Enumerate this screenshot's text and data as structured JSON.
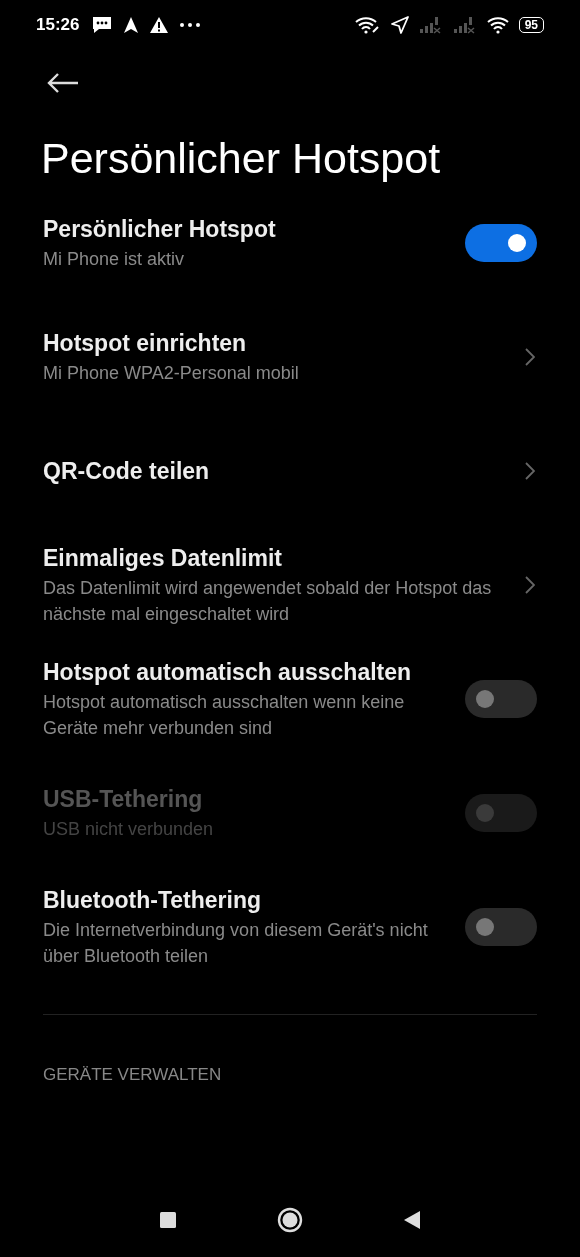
{
  "status_bar": {
    "time": "15:26",
    "battery": "95"
  },
  "title": "Persönlicher Hotspot",
  "settings": [
    {
      "kind": "toggle",
      "title": "Persönlicher Hotspot",
      "subtitle": "Mi Phone ist aktiv",
      "on": true,
      "disabled": false
    },
    {
      "kind": "link",
      "title": "Hotspot einrichten",
      "subtitle": "Mi Phone WPA2-Personal mobil"
    },
    {
      "kind": "link",
      "title": "QR-Code teilen"
    },
    {
      "kind": "link",
      "title": "Einmaliges Datenlimit",
      "subtitle": "Das Datenlimit wird angewendet sobald der Hotspot das nächste mal eingeschaltet wird"
    },
    {
      "kind": "toggle",
      "title": "Hotspot automatisch ausschalten",
      "subtitle": "Hotspot automatisch ausschalten wenn keine Geräte mehr verbunden sind",
      "on": false,
      "disabled": false
    },
    {
      "kind": "toggle",
      "title": "USB-Tethering",
      "subtitle": "USB nicht verbunden",
      "on": false,
      "disabled": true
    },
    {
      "kind": "toggle",
      "title": "Bluetooth-Tethering",
      "subtitle": "Die Internetverbindung von diesem Gerät's nicht über Bluetooth teilen",
      "on": false,
      "disabled": false
    }
  ],
  "section_header": "GERÄTE VERWALTEN"
}
